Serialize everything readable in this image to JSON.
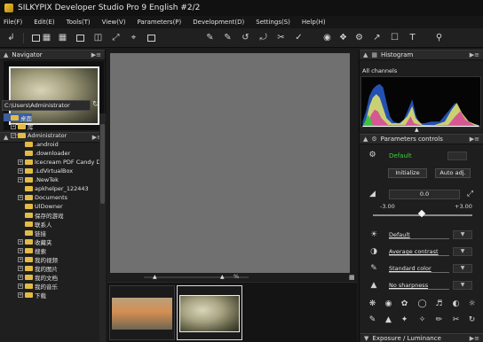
{
  "window": {
    "title": "SILKYPIX Developer Studio Pro 9 English  #2/2"
  },
  "menu": [
    "File(F)",
    "Edit(E)",
    "Tools(T)",
    "View(V)",
    "Parameters(P)",
    "Development(D)",
    "Settings(S)",
    "Help(H)"
  ],
  "navigator": {
    "title": "Navigator"
  },
  "folders": {
    "path": "C:\\Users\\Administrator",
    "tree": [
      {
        "label": "桌面",
        "indent": 0,
        "exp": "",
        "selected": true
      },
      {
        "label": "库",
        "indent": 1,
        "exp": "+"
      },
      {
        "label": "Administrator",
        "indent": 1,
        "exp": "-"
      },
      {
        "label": ".android",
        "indent": 2,
        "exp": ""
      },
      {
        "label": ".downloader",
        "indent": 2,
        "exp": ""
      },
      {
        "label": "Icecream PDF Candy De",
        "indent": 2,
        "exp": "+"
      },
      {
        "label": ".LdVirtualBox",
        "indent": 2,
        "exp": "+"
      },
      {
        "label": ".NewTek",
        "indent": 2,
        "exp": "+"
      },
      {
        "label": "apkhelper_122443",
        "indent": 2,
        "exp": ""
      },
      {
        "label": "Documents",
        "indent": 2,
        "exp": "+"
      },
      {
        "label": "UlDowner",
        "indent": 2,
        "exp": ""
      },
      {
        "label": "保存的游戏",
        "indent": 2,
        "exp": ""
      },
      {
        "label": "联系人",
        "indent": 2,
        "exp": ""
      },
      {
        "label": "链接",
        "indent": 2,
        "exp": ""
      },
      {
        "label": "收藏夹",
        "indent": 2,
        "exp": "+"
      },
      {
        "label": "搜索",
        "indent": 2,
        "exp": "+"
      },
      {
        "label": "我的视频",
        "indent": 2,
        "exp": "+"
      },
      {
        "label": "我的图片",
        "indent": 2,
        "exp": "+"
      },
      {
        "label": "我的文档",
        "indent": 2,
        "exp": "+"
      },
      {
        "label": "我的音乐",
        "indent": 2,
        "exp": "+"
      },
      {
        "label": "下载",
        "indent": 2,
        "exp": "+"
      }
    ]
  },
  "preview": {
    "zoom_label": "%"
  },
  "histogram": {
    "title": "Histogram",
    "channel": "All channels"
  },
  "parameters": {
    "title": "Parameters controls",
    "taste": "Default",
    "initialize_label": "Initialize",
    "auto_adj_label": "Auto adj.",
    "exposure_value": "0.0",
    "ev_min": "-3.00",
    "ev_max": "+3.00",
    "white_balance": "Default",
    "tone": "Average contrast",
    "color": "Standard color",
    "sharpness": "No sharpness"
  },
  "footer": {
    "exposure_label": "Exposure / Luminance"
  }
}
